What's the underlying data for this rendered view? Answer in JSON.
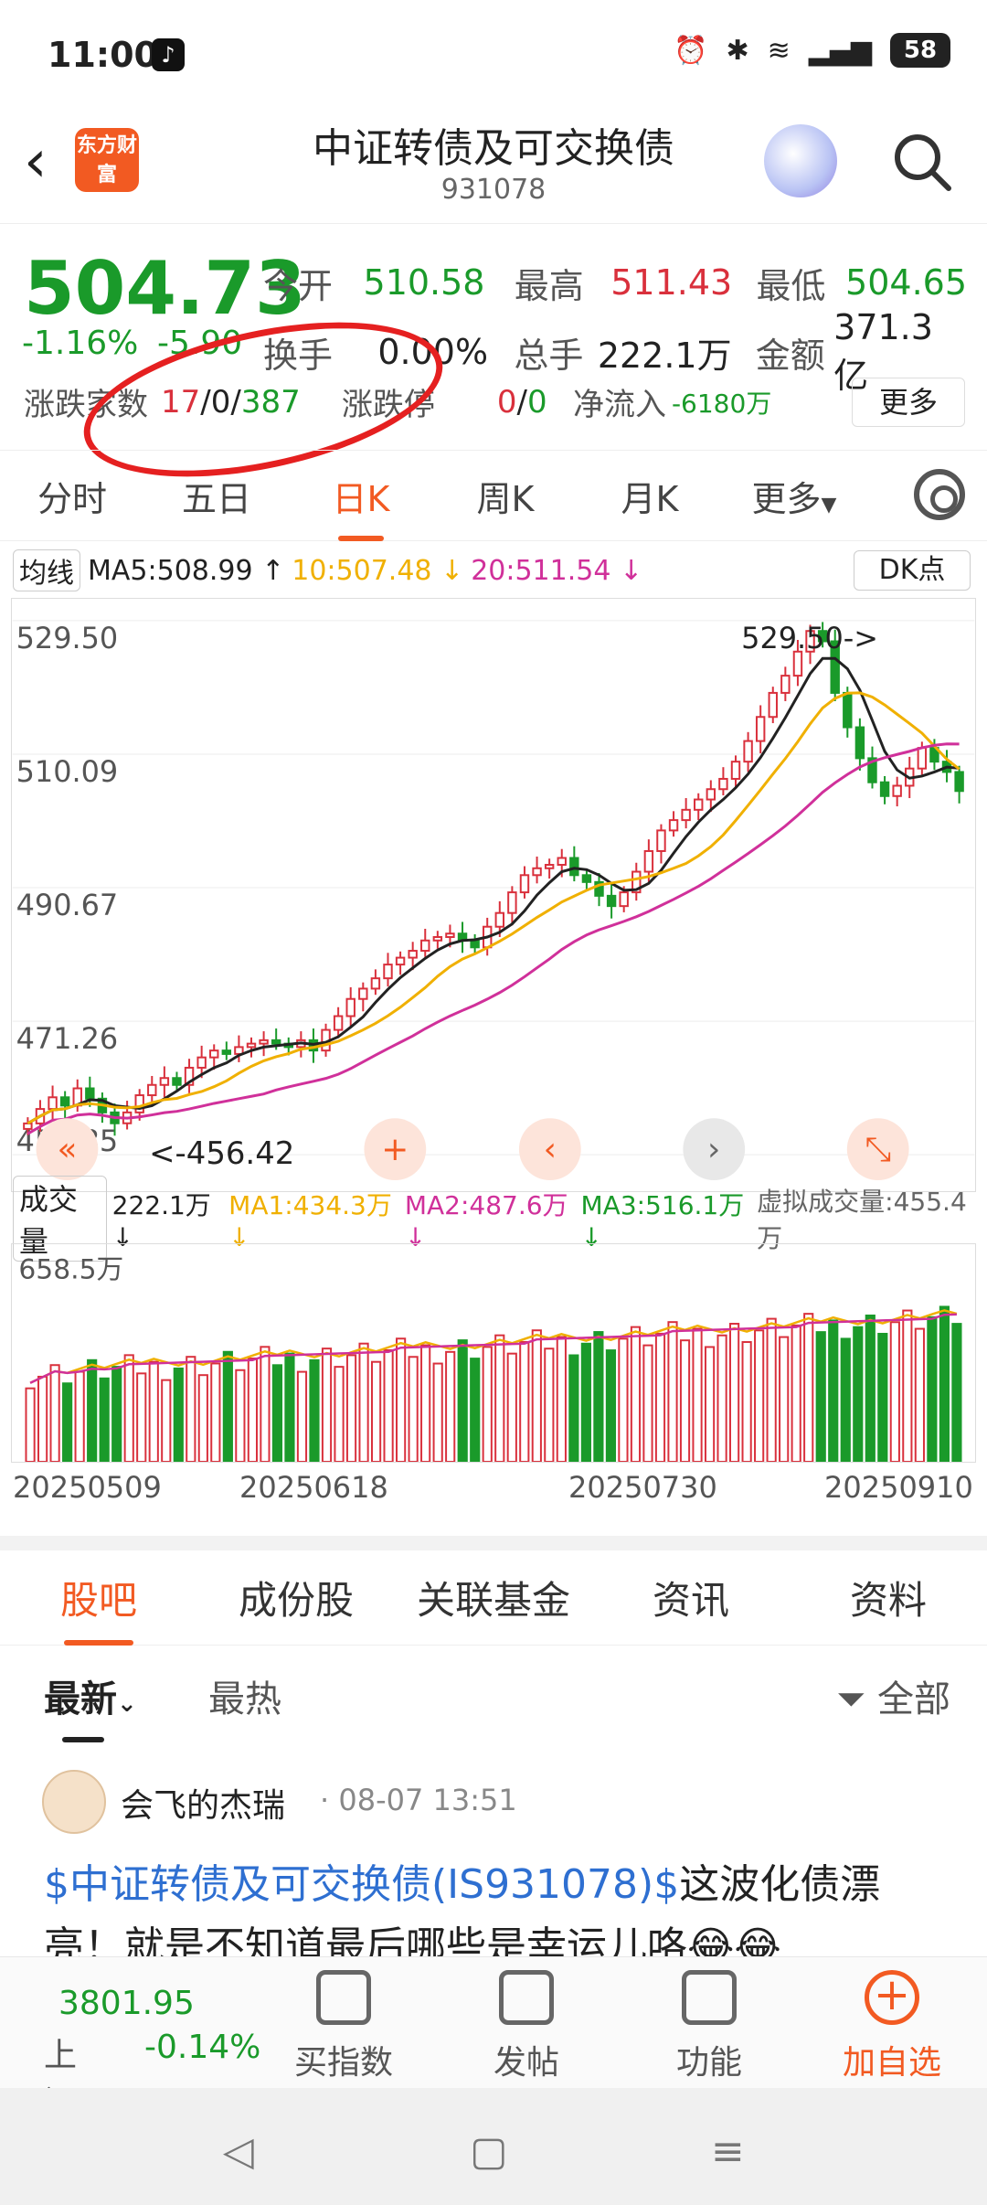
{
  "status_bar": {
    "time": "11:00",
    "battery": "58",
    "icons": [
      "tiktok-icon",
      "alarm-icon",
      "bluetooth-icon",
      "wifi-icon",
      "5g-signal-icon",
      "battery-icon"
    ]
  },
  "header": {
    "logo_text": "东方财富",
    "title": "中证转债及可交换债",
    "code": "931078"
  },
  "quote": {
    "price": "504.73",
    "change_pct": "-1.16%",
    "change": "-5.90",
    "open_label": "今开",
    "open": "510.58",
    "high_label": "最高",
    "high": "511.43",
    "low_label": "最低",
    "low": "504.65",
    "turnover_label": "换手",
    "turnover": "0.00%",
    "volume_label": "总手",
    "volume": "222.1万",
    "amount_label": "金额",
    "amount": "371.3亿",
    "updown_label": "涨跌家数",
    "up": "17",
    "flat": "0",
    "down": "387",
    "limit_label": "涨跌停",
    "limit_up": "0",
    "limit_down": "0",
    "netflow_label": "净流入",
    "netflow": "-6180万",
    "more_button": "更多"
  },
  "tabs": [
    "分时",
    "五日",
    "日K",
    "周K",
    "月K",
    "更多"
  ],
  "active_tab": "日K",
  "ma_legend": {
    "toggle": "均线",
    "ma5": "MA5:508.99 ↑",
    "ma10": "10:507.48 ↓",
    "ma20": "20:511.54 ↓",
    "dk": "DK点"
  },
  "colors": {
    "up": "#d9303c",
    "down": "#1a9a2a",
    "ma5": "#222222",
    "ma10": "#f0b000",
    "ma20": "#d0309a",
    "accent": "#f25a22"
  },
  "chart_data": {
    "type": "candlestick",
    "y_ticks": [
      "529.50",
      "510.09",
      "490.67",
      "471.26",
      "451.85"
    ],
    "ylim": [
      451.85,
      529.5
    ],
    "max_label": "529.50->",
    "min_label": "<-456.42",
    "x_labels": [
      "20250509",
      "20250618",
      "20250730",
      "20250910"
    ],
    "closes": [
      456.4,
      458.5,
      460.2,
      459.0,
      461.5,
      460.0,
      458.0,
      456.42,
      458.0,
      460.5,
      462.0,
      463.0,
      462.0,
      464.5,
      466.0,
      467.0,
      466.5,
      467.5,
      468.0,
      468.5,
      468.0,
      467.5,
      468.5,
      467.0,
      470.0,
      472.0,
      474.5,
      476.0,
      477.5,
      479.5,
      480.5,
      481.5,
      483.0,
      483.5,
      484.0,
      483.0,
      482.0,
      485.0,
      487.0,
      490.0,
      492.5,
      493.5,
      494.0,
      495.0,
      492.5,
      491.5,
      489.5,
      488.0,
      490.0,
      493.0,
      496.0,
      499.0,
      500.5,
      502.0,
      503.5,
      505.0,
      506.5,
      509.0,
      512.0,
      515.5,
      519.0,
      521.5,
      525.0,
      528.0,
      526.5,
      519.0,
      514.0,
      509.5,
      506.0,
      504.0,
      505.5,
      508.0,
      511.0,
      509.0,
      507.5,
      504.73
    ],
    "volume_legend": {
      "toggle": "成交量",
      "vol": "222.1万↓",
      "ma1": "MA1:434.3万↓",
      "ma2": "MA2:487.6万↓",
      "ma3": "MA3:516.1万↓",
      "virtual": "虚拟成交量:455.4万"
    },
    "vol_y_tick": "658.5万"
  },
  "bottom_tabs": [
    "股吧",
    "成份股",
    "关联基金",
    "资讯",
    "资料"
  ],
  "filter": {
    "latest": "最新",
    "hot": "最热",
    "all": "全部"
  },
  "post": {
    "user": "会飞的杰瑞",
    "time": "· 08-07 13:51",
    "link": "$中证转债及可交换债(IS931078)$",
    "text": "这波化债漂亮！就是不知道最后哪些是幸运儿咯😂😂"
  },
  "bottom_bar": {
    "index_value": "3801.95",
    "index_name": "上证",
    "index_pct": "-0.14%",
    "buy_index": "买指数",
    "post": "发帖",
    "functions": "功能",
    "add_watch": "加自选"
  },
  "nav": {
    "back": "◁",
    "home": "▢",
    "menu": "≡"
  }
}
